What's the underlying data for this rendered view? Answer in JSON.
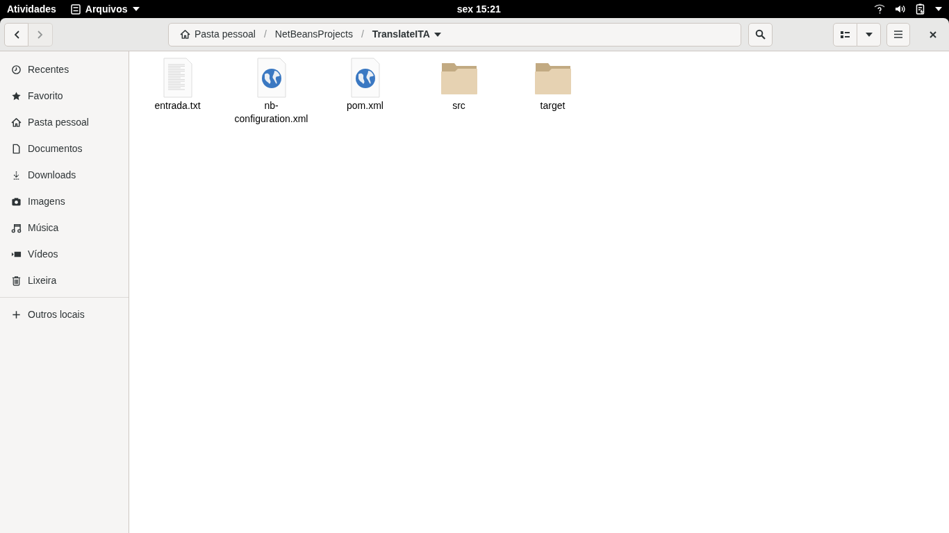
{
  "top_bar": {
    "activities": "Atividades",
    "app_menu": "Arquivos",
    "clock": "sex 15:21"
  },
  "header": {
    "nav": [
      {
        "kind": "back",
        "disabled": false
      },
      {
        "kind": "forward",
        "disabled": true
      }
    ],
    "path": [
      {
        "label": "Pasta pessoal",
        "kind": "home",
        "selected": false
      },
      {
        "label": "NetBeansProjects",
        "kind": "folder",
        "selected": false
      },
      {
        "label": "TranslateITA",
        "kind": "folder",
        "selected": true
      }
    ],
    "separators": [
      "/",
      "/"
    ]
  },
  "sidebar": {
    "items": [
      {
        "label": "Recentes",
        "kind": "recent"
      },
      {
        "label": "Favorito",
        "kind": "star"
      },
      {
        "label": "Pasta pessoal",
        "kind": "home"
      },
      {
        "label": "Documentos",
        "kind": "document"
      },
      {
        "label": "Downloads",
        "kind": "download"
      },
      {
        "label": "Imagens",
        "kind": "camera"
      },
      {
        "label": "Música",
        "kind": "music"
      },
      {
        "label": "Vídeos",
        "kind": "video"
      },
      {
        "label": "Lixeira",
        "kind": "trash"
      },
      {
        "label": "Outros locais",
        "kind": "plus"
      }
    ]
  },
  "files": [
    {
      "name": "entrada.txt",
      "kind": "text"
    },
    {
      "name": "nb-configuration.xml",
      "kind": "web"
    },
    {
      "name": "pom.xml",
      "kind": "web"
    },
    {
      "name": "src",
      "kind": "folder"
    },
    {
      "name": "target",
      "kind": "folder"
    }
  ]
}
